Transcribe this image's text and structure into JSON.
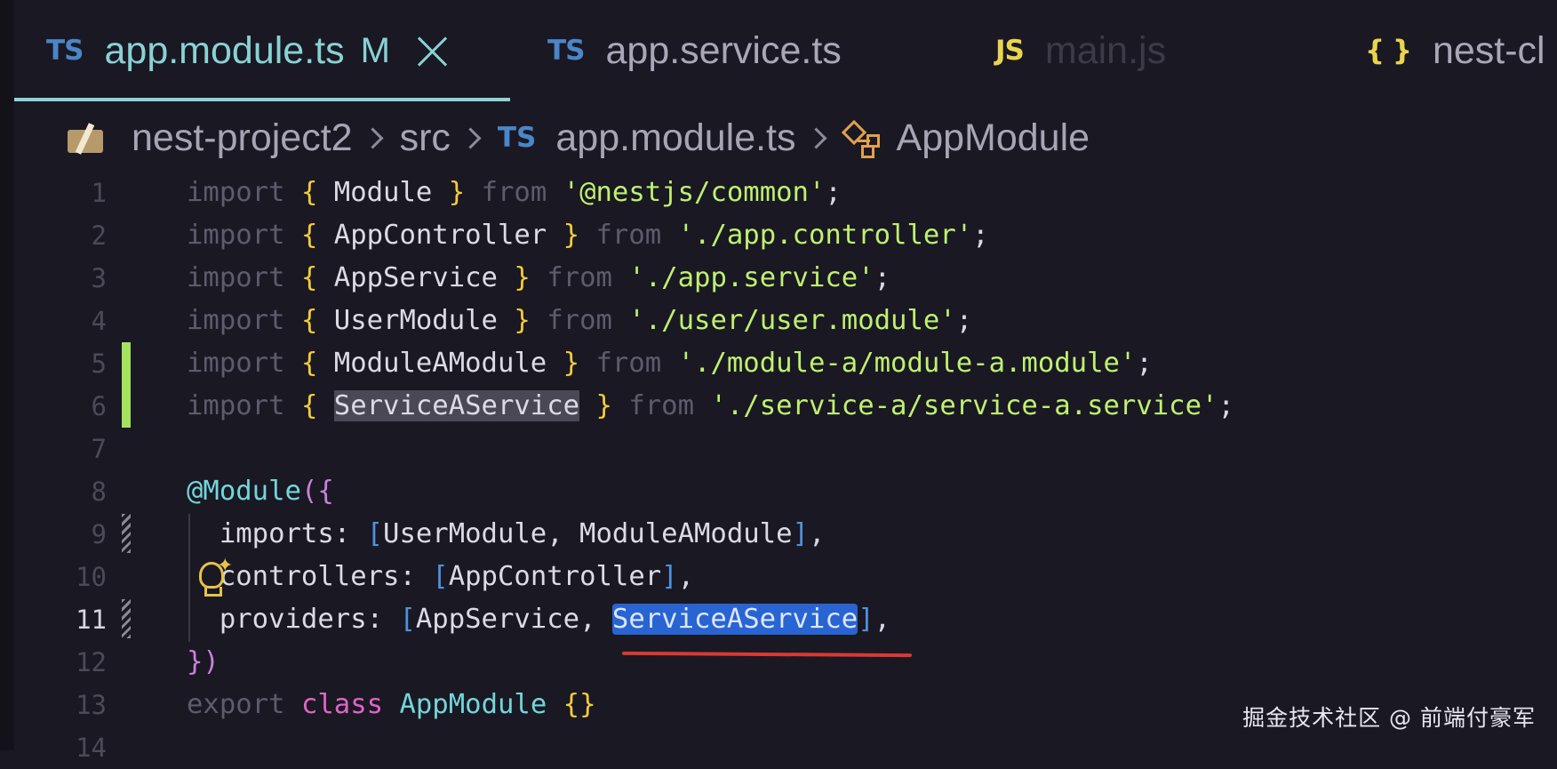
{
  "tabs": [
    {
      "badge": "TS",
      "name": "app.module.ts",
      "modified": "M",
      "active": true
    },
    {
      "badge": "TS",
      "name": "app.service.ts"
    },
    {
      "badge": "JS",
      "name": "main.js"
    },
    {
      "badge": "{ }",
      "name": "nest-cl"
    }
  ],
  "breadcrumb": {
    "folder": "nest-project2",
    "dir": "src",
    "file_badge": "TS",
    "file": "app.module.ts",
    "symbol": "AppModule"
  },
  "lines": [
    {
      "n": "1",
      "t": [
        "import",
        " ",
        "{",
        " Module ",
        "}",
        " ",
        "from",
        " ",
        "'@nestjs/common'",
        ";"
      ]
    },
    {
      "n": "2",
      "t": [
        "import",
        " ",
        "{",
        " AppController ",
        "}",
        " ",
        "from",
        " ",
        "'./app.controller'",
        ";"
      ]
    },
    {
      "n": "3",
      "t": [
        "import",
        " ",
        "{",
        " AppService ",
        "}",
        " ",
        "from",
        " ",
        "'./app.service'",
        ";"
      ]
    },
    {
      "n": "4",
      "t": [
        "import",
        " ",
        "{",
        " UserModule ",
        "}",
        " ",
        "from",
        " ",
        "'./user/user.module'",
        ";"
      ]
    },
    {
      "n": "5",
      "t": [
        "import",
        " ",
        "{",
        " ModuleAModule ",
        "}",
        " ",
        "from",
        " ",
        "'./module-a/module-a.module'",
        ";"
      ]
    },
    {
      "n": "6",
      "t": [
        "import",
        " ",
        "{",
        " ",
        "ServiceAService",
        " ",
        "}",
        " ",
        "from",
        " ",
        "'./service-a/service-a.service'",
        ";"
      ]
    },
    {
      "n": "7",
      "t": []
    },
    {
      "n": "8",
      "t": [
        "@Module",
        "(",
        "{"
      ]
    },
    {
      "n": "9",
      "t": [
        "  imports: ",
        "[",
        "UserModule, ModuleAModule",
        "]",
        ","
      ]
    },
    {
      "n": "10",
      "t": [
        "  controllers: ",
        "[",
        "AppController",
        "]",
        ","
      ]
    },
    {
      "n": "11",
      "t": [
        "  providers: ",
        "[",
        "AppService, ",
        "ServiceAService",
        "]",
        ","
      ]
    },
    {
      "n": "12",
      "t": [
        "}",
        ")"
      ]
    },
    {
      "n": "13",
      "t": [
        "export",
        " ",
        "class",
        " ",
        "AppModule",
        " ",
        "{}"
      ]
    },
    {
      "n": "14",
      "t": []
    }
  ],
  "watermark": "掘金技术社区 @ 前端付豪军",
  "colors": {
    "background": "#1a1823",
    "accent_tab": "#88d2d3",
    "string": "#bef170",
    "brace": "#f2cc3c",
    "selection": "#2864d2",
    "underline": "#d83a33",
    "gutter_added": "#a5e35e"
  }
}
